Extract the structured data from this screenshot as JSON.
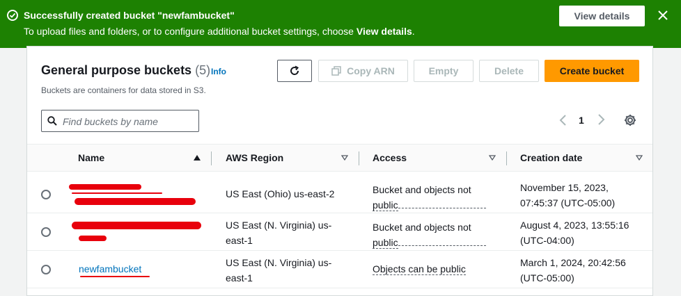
{
  "flash": {
    "title": "Successfully created bucket \"newfambucket\"",
    "message_prefix": "To upload files and folders, or to configure additional bucket settings, choose ",
    "message_link": "View details",
    "message_suffix": ".",
    "view_details_button": "View details",
    "color": "#1d8102"
  },
  "header": {
    "title": "General purpose buckets",
    "count": "(5)",
    "info": "Info",
    "description": "Buckets are containers for data stored in S3."
  },
  "actions": {
    "copy_arn": "Copy ARN",
    "empty": "Empty",
    "delete": "Delete",
    "create_bucket": "Create bucket"
  },
  "search": {
    "placeholder": "Find buckets by name",
    "value": ""
  },
  "pagination": {
    "current_page": "1"
  },
  "table": {
    "columns": [
      "Name",
      "AWS Region",
      "Access",
      "Creation date"
    ],
    "rows": [
      {
        "name": "",
        "region_line1": "US East (Ohio) us-east-2",
        "region_line2": "",
        "access_line1": "Bucket and objects not",
        "access_line2": "public",
        "date_line1": "November 15, 2023,",
        "date_line2": "07:45:37 (UTC-05:00)"
      },
      {
        "name": "",
        "region_line1": "US East (N. Virginia) us-",
        "region_line2": "east-1",
        "access_line1": "Bucket and objects not",
        "access_line2": "public",
        "date_line1": "August 4, 2023, 13:55:16",
        "date_line2": "(UTC-04:00)"
      },
      {
        "name": "newfambucket",
        "region_line1": "US East (N. Virginia) us-",
        "region_line2": "east-1",
        "access_line1": "Objects can be public",
        "access_line2": "",
        "date_line1": "March 1, 2024, 20:42:56",
        "date_line2": "(UTC-05:00)"
      }
    ]
  },
  "colors": {
    "accent_orange": "#ff9900",
    "link_blue": "#0073bb",
    "redaction_red": "#e8000c"
  }
}
